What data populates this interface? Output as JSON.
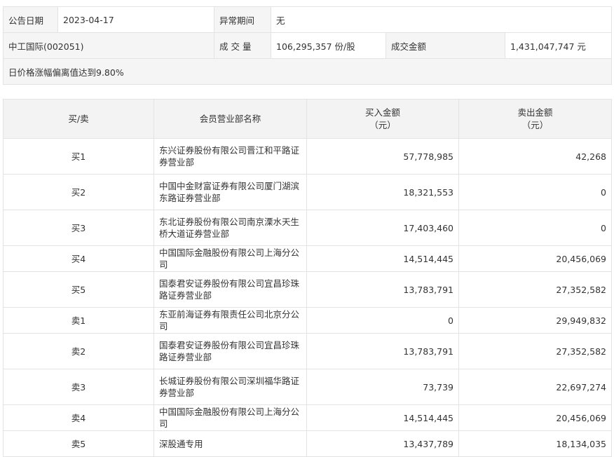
{
  "info": {
    "date_label": "公告日期",
    "date_value": "2023-04-17",
    "period_label": "异常期间",
    "period_value": "无",
    "stock": "中工国际(002051)",
    "volume_label": "成 交 量",
    "volume_value": "106,295,357 份/股",
    "amount_label": "成交金额",
    "amount_value": "1,431,047,747 元",
    "reason": "日价格涨幅偏离值达到9.80%"
  },
  "table": {
    "headers": {
      "side": "买/卖",
      "name": "会员营业部名称",
      "buy_line1": "买入金额",
      "buy_line2": "（元）",
      "sell_line1": "卖出金额",
      "sell_line2": "（元）"
    },
    "rows": [
      {
        "side": "买1",
        "name": "东兴证券股份有限公司晋江和平路证券营业部",
        "buy": "57,778,985",
        "sell": "42,268"
      },
      {
        "side": "买2",
        "name": "中国中金财富证券有限公司厦门湖滨东路证券营业部",
        "buy": "18,321,553",
        "sell": "0"
      },
      {
        "side": "买3",
        "name": "东北证券股份有限公司南京溧水天生桥大道证券营业部",
        "buy": "17,403,460",
        "sell": "0"
      },
      {
        "side": "买4",
        "name": "中国国际金融股份有限公司上海分公司",
        "buy": "14,514,445",
        "sell": "20,456,069"
      },
      {
        "side": "买5",
        "name": "国泰君安证券股份有限公司宜昌珍珠路证券营业部",
        "buy": "13,783,791",
        "sell": "27,352,582"
      },
      {
        "side": "卖1",
        "name": "东亚前海证券有限责任公司北京分公司",
        "buy": "0",
        "sell": "29,949,832"
      },
      {
        "side": "卖2",
        "name": "国泰君安证券股份有限公司宜昌珍珠路证券营业部",
        "buy": "13,783,791",
        "sell": "27,352,582"
      },
      {
        "side": "卖3",
        "name": "长城证券股份有限公司深圳福华路证券营业部",
        "buy": "73,739",
        "sell": "22,697,274"
      },
      {
        "side": "卖4",
        "name": "中国国际金融股份有限公司上海分公司",
        "buy": "14,514,445",
        "sell": "20,456,069"
      },
      {
        "side": "卖5",
        "name": "深股通专用",
        "buy": "13,437,789",
        "sell": "18,134,035"
      }
    ]
  }
}
